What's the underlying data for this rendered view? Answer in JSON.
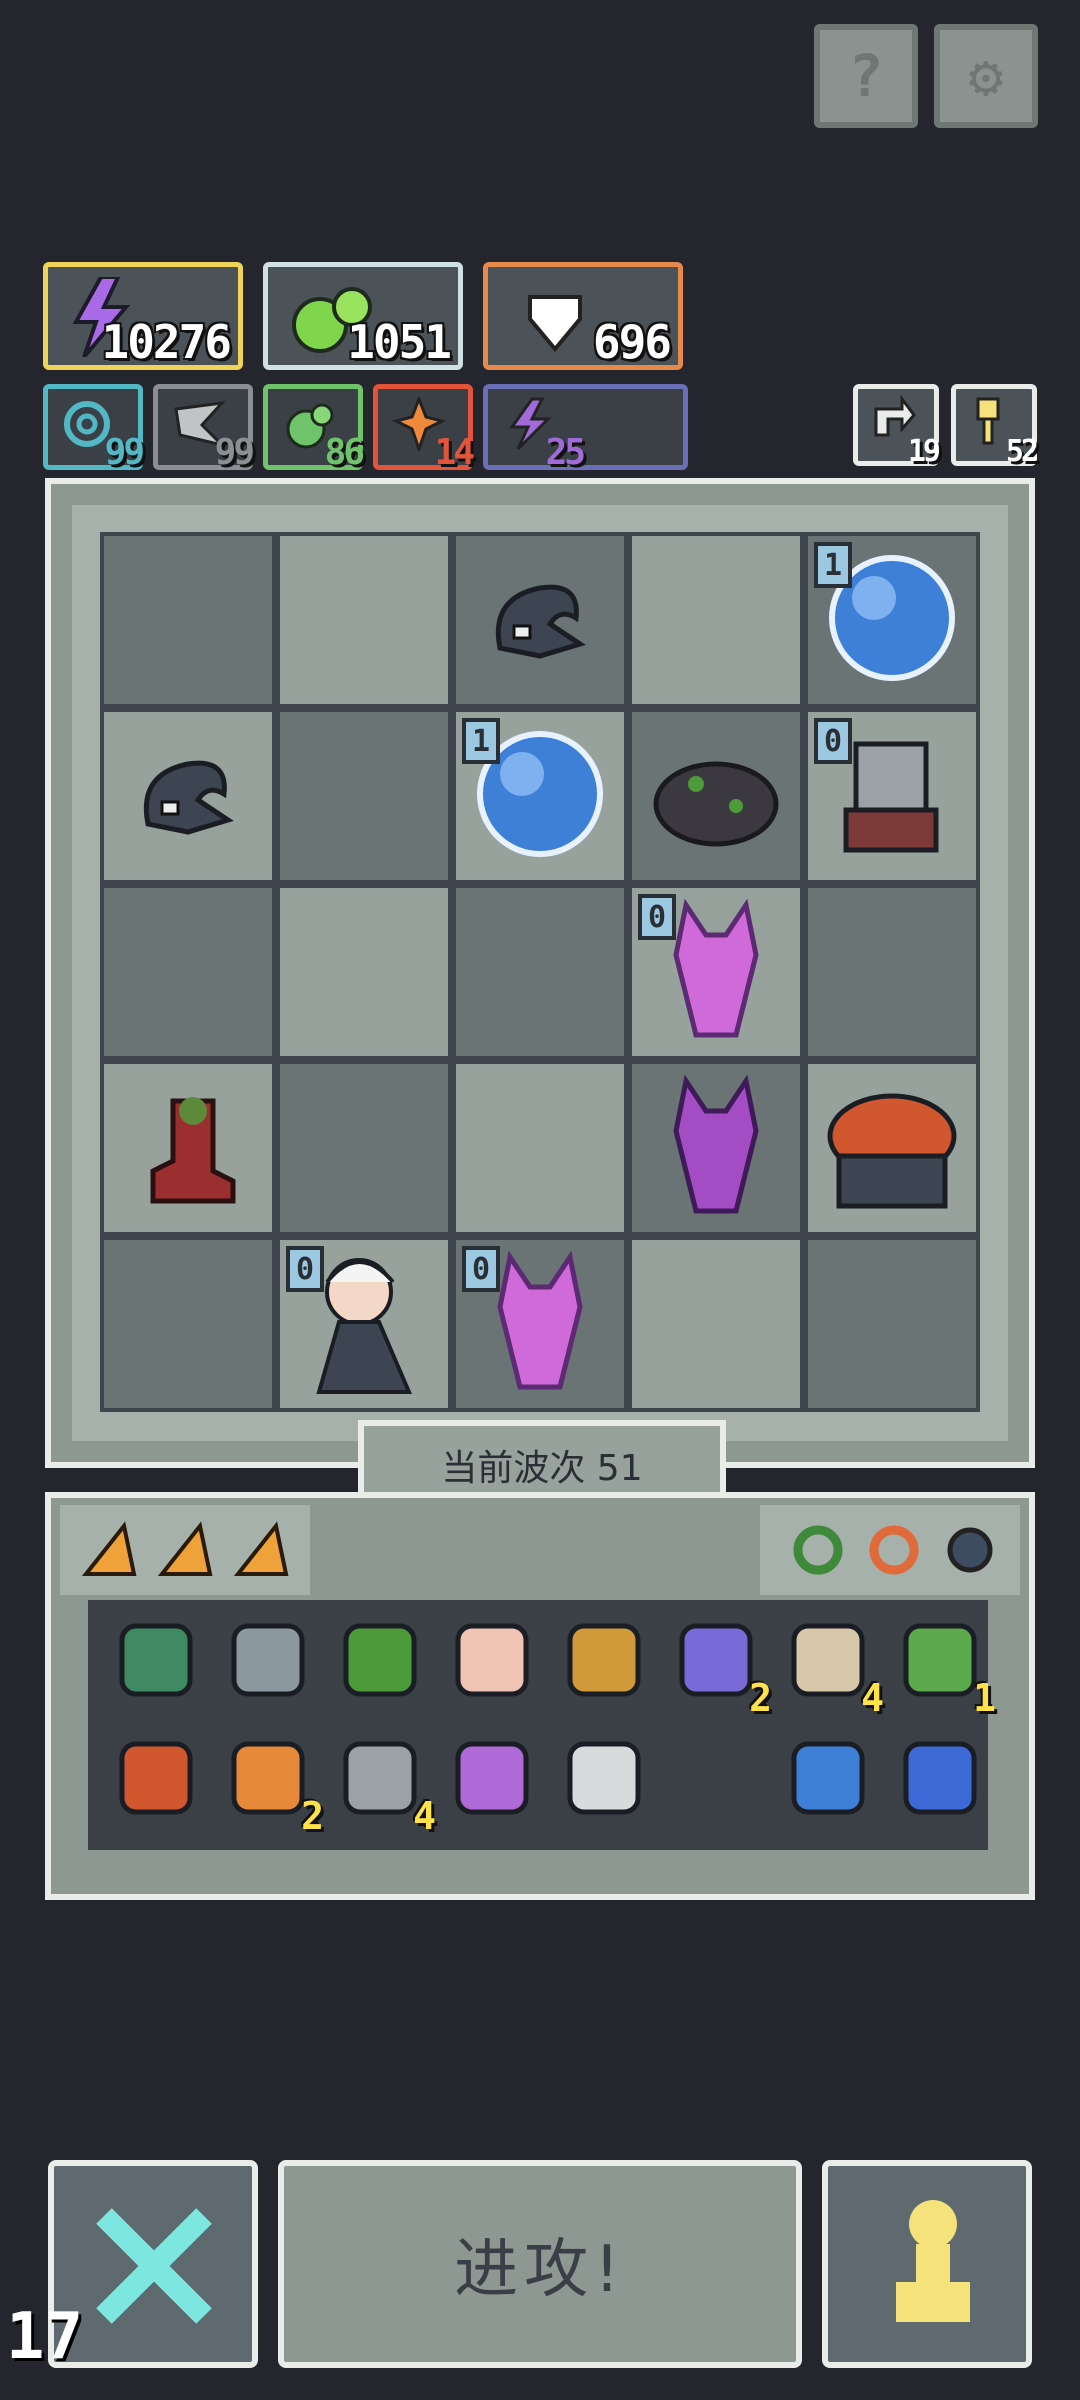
{
  "top_buttons": {
    "help_glyph": "?",
    "settings_glyph": "⚙"
  },
  "resources": [
    {
      "name": "energy",
      "value": "10276",
      "color": "#f2d35a"
    },
    {
      "name": "seeds",
      "value": "1051",
      "color": "#cfe1e4"
    },
    {
      "name": "heart",
      "value": "696",
      "color": "#e68a4b"
    }
  ],
  "stats": [
    {
      "name": "swirl",
      "value": "99",
      "color": "#52b8c5"
    },
    {
      "name": "wind",
      "value": "99",
      "color": "#8a8f93"
    },
    {
      "name": "seed",
      "value": "86",
      "color": "#6fc36a"
    },
    {
      "name": "fire",
      "value": "14",
      "color": "#e2553b"
    },
    {
      "name": "bolt",
      "value": "25",
      "color": "#a06ad8"
    }
  ],
  "counters": [
    {
      "name": "cycle",
      "value": "19"
    },
    {
      "name": "key",
      "value": "52"
    }
  ],
  "board": {
    "rows": [
      [
        "",
        "",
        "hood",
        "",
        "orb"
      ],
      [
        "hood",
        "",
        "orb",
        "rock",
        "knight"
      ],
      [
        "",
        "",
        "",
        "demon",
        ""
      ],
      [
        "boot",
        "",
        "",
        "demon2",
        "toad"
      ],
      [
        "",
        "hero",
        "demon",
        "",
        ""
      ]
    ],
    "levels": [
      [
        "",
        "",
        "",
        "",
        "1"
      ],
      [
        "",
        "",
        "1",
        "",
        "0"
      ],
      [
        "",
        "",
        "",
        "0",
        ""
      ],
      [
        "",
        "",
        "",
        "",
        ""
      ],
      [
        "",
        "0",
        "0",
        "",
        ""
      ]
    ]
  },
  "wave_label": "当前波次 51",
  "inventory": {
    "top_items": [
      "cheese",
      "cheese",
      "cheese"
    ],
    "rings": [
      "ring-green",
      "ring-orange",
      "ring-blue"
    ],
    "row1": [
      {
        "icon": "helmet",
        "qty": ""
      },
      {
        "icon": "hammer",
        "qty": ""
      },
      {
        "icon": "axe",
        "qty": ""
      },
      {
        "icon": "hand",
        "qty": ""
      },
      {
        "icon": "crown",
        "qty": ""
      },
      {
        "icon": "potion",
        "qty": "2"
      },
      {
        "icon": "scroll",
        "qty": "4"
      },
      {
        "icon": "vine",
        "qty": "1"
      }
    ],
    "row2": [
      {
        "icon": "chest",
        "qty": ""
      },
      {
        "icon": "torch",
        "qty": "2"
      },
      {
        "icon": "machine",
        "qty": "4"
      },
      {
        "icon": "arrow",
        "qty": ""
      },
      {
        "icon": "egg",
        "qty": ""
      },
      {
        "icon": "empty",
        "qty": ""
      },
      {
        "icon": "drop",
        "qty": ""
      },
      {
        "icon": "rune",
        "qty": ""
      }
    ]
  },
  "buttons": {
    "cancel_glyph": "✕",
    "attack_label": "进攻!",
    "pawn_glyph": "♟"
  },
  "corner_counter": "17"
}
